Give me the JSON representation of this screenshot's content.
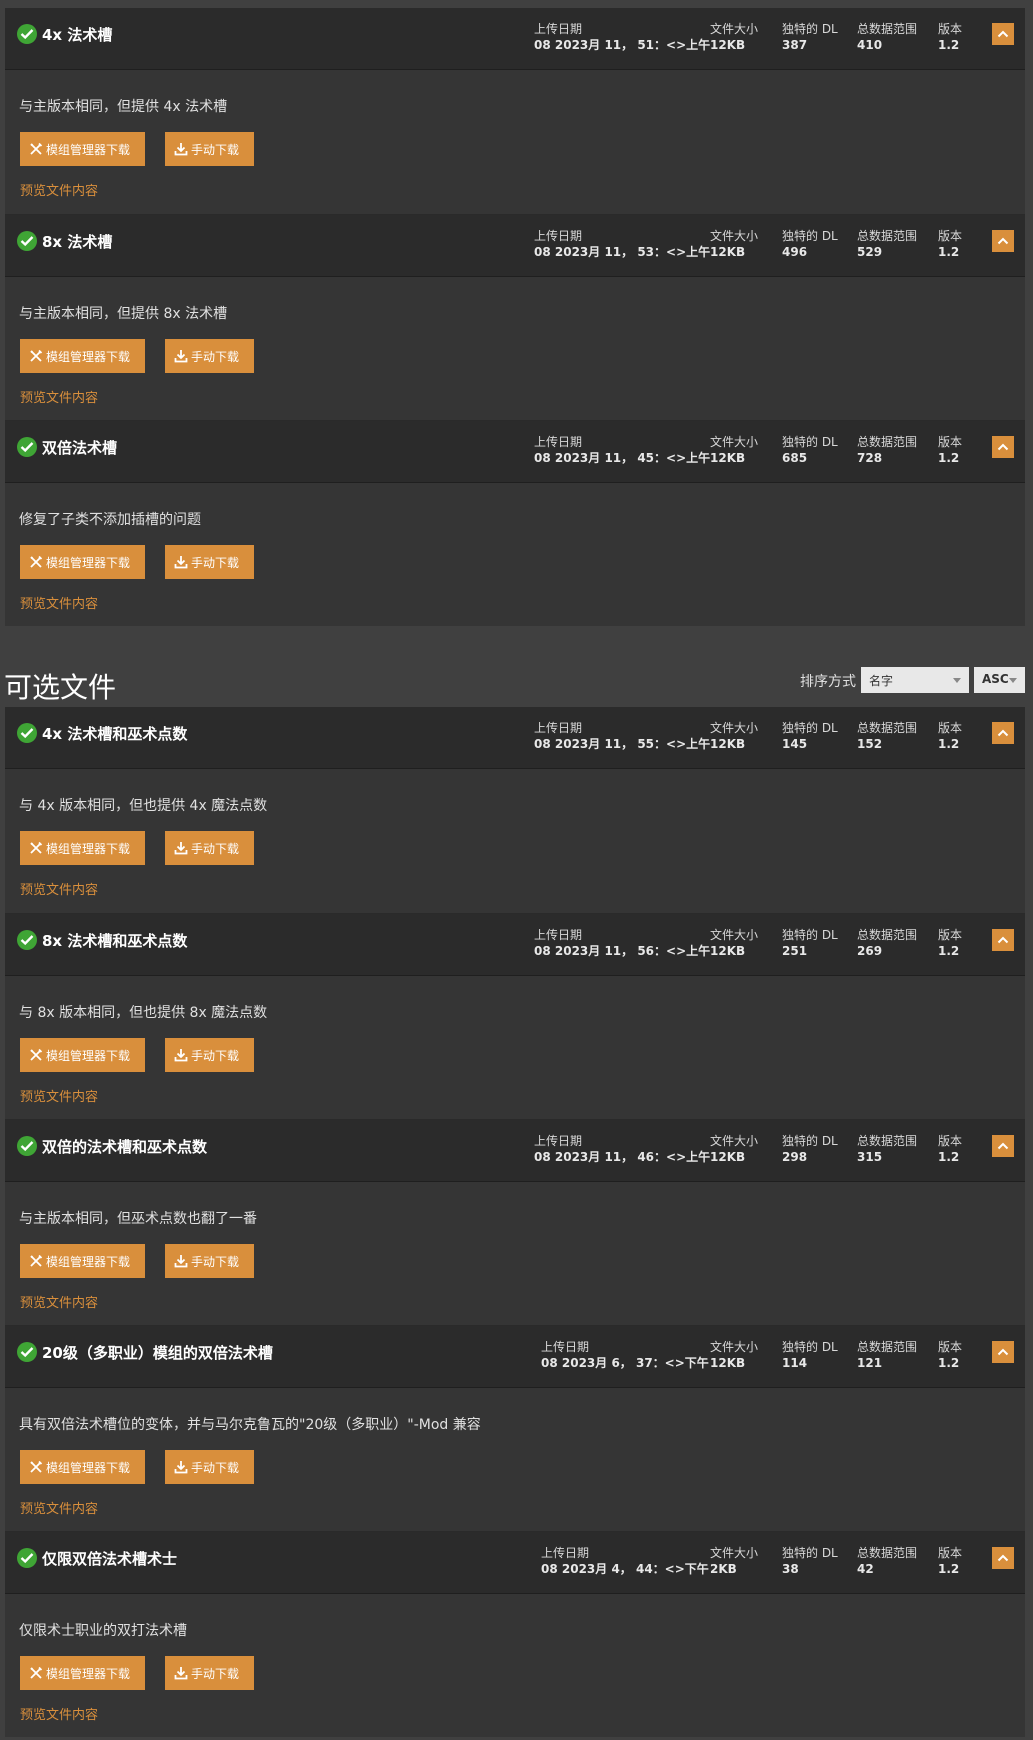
{
  "labels": {
    "upload_date": "上传日期",
    "file_size": "文件大小",
    "unique_dl": "独特的 DL",
    "total_dl": "总数据范围",
    "version": "版本",
    "mod_manager_download": "模组管理器下载",
    "manual_download": "手动下载",
    "preview": "预览文件内容"
  },
  "main_files": [
    {
      "name": "4x 法术槽",
      "date": "08 2023月 11， 51：<>上午",
      "size": "12KB",
      "unique": "387",
      "total": "410",
      "version": "1.2",
      "desc": "与主版本相同，但提供 4x 法术槽"
    },
    {
      "name": "8x 法术槽",
      "date": "08 2023月 11， 53：<>上午",
      "size": "12KB",
      "unique": "496",
      "total": "529",
      "version": "1.2",
      "desc": "与主版本相同，但提供 8x 法术槽"
    },
    {
      "name": "双倍法术槽",
      "date": "08 2023月 11， 45：<>上午",
      "size": "12KB",
      "unique": "685",
      "total": "728",
      "version": "1.2",
      "desc": "修复了子类不添加插槽的问题"
    }
  ],
  "optional_section": {
    "title": "可选文件",
    "sort_label": "排序方式",
    "sort_value": "名字",
    "sort_order": "ASC"
  },
  "optional_files": [
    {
      "name": "4x 法术槽和巫术点数",
      "date": "08 2023月 11， 55：<>上午",
      "size": "12KB",
      "unique": "145",
      "total": "152",
      "version": "1.2",
      "desc": "与 4x 版本相同，但也提供 4x 魔法点数"
    },
    {
      "name": "8x 法术槽和巫术点数",
      "date": "08 2023月 11， 56：<>上午",
      "size": "12KB",
      "unique": "251",
      "total": "269",
      "version": "1.2",
      "desc": "与 8x 版本相同，但也提供 8x 魔法点数"
    },
    {
      "name": "双倍的法术槽和巫术点数",
      "date": "08 2023月 11， 46：<>上午",
      "size": "12KB",
      "unique": "298",
      "total": "315",
      "version": "1.2",
      "desc": "与主版本相同，但巫术点数也翻了一番"
    },
    {
      "name": "20级（多职业）模组的双倍法术槽",
      "date": "08 2023月 6， 37：<>下午",
      "size": "12KB",
      "unique": "114",
      "total": "121",
      "version": "1.2",
      "desc": "具有双倍法术槽位的变体，并与马尔克鲁瓦的\"20级（多职业）\"-Mod 兼容",
      "wide": true
    },
    {
      "name": "仅限双倍法术槽术士",
      "date": "08 2023月 4， 44：<>下午",
      "size": "2KB",
      "unique": "38",
      "total": "42",
      "version": "1.2",
      "desc": "仅限术士职业的双打法术槽",
      "wide": true
    }
  ],
  "colors": {
    "accent": "#d98f3c",
    "check": "#3fa535",
    "header_bg": "#2b2b2b",
    "card_bg": "#353535",
    "page_bg": "#404040"
  }
}
